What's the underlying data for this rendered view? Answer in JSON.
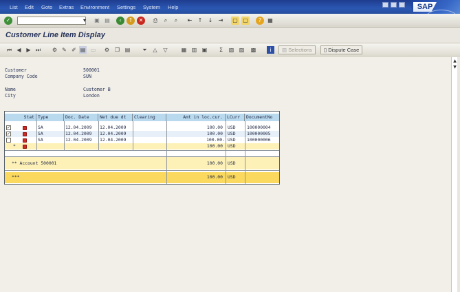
{
  "menu": [
    "List",
    "Edit",
    "Goto",
    "Extras",
    "Environment",
    "Settings",
    "System",
    "Help"
  ],
  "brand": "SAP",
  "title": "Customer Line Item Display",
  "app_buttons": {
    "selections": "Selections",
    "dispute_case": "Dispute Case"
  },
  "header_fields": [
    {
      "label": "Customer",
      "value": "500001"
    },
    {
      "label": "Company Code",
      "value": "SUN"
    },
    {
      "label": "Name",
      "value": "Customer B"
    },
    {
      "label": "City",
      "value": "London"
    }
  ],
  "table": {
    "columns": [
      "Stat",
      "Type",
      "Doc. Date",
      "Net due dt",
      "Clearing",
      "Amt in loc.cur.",
      "LCurr",
      "DocumentNo"
    ],
    "rows": [
      {
        "checked": true,
        "type": "SA",
        "doc_date": "12.04.2009",
        "net_due": "12.04.2009",
        "clearing": "",
        "amount": "100.00",
        "curr": "USD",
        "doc_no": "100000004"
      },
      {
        "checked": true,
        "type": "SA",
        "doc_date": "12.04.2009",
        "net_due": "12.04.2009",
        "clearing": "",
        "amount": "100.00",
        "curr": "USD",
        "doc_no": "100000005"
      },
      {
        "checked": false,
        "type": "SA",
        "doc_date": "12.04.2009",
        "net_due": "12.04.2009",
        "clearing": "",
        "amount": "100.00-",
        "curr": "USD",
        "doc_no": "100000006"
      }
    ],
    "subtotal_marker": "*",
    "subtotal": {
      "amount": "100.00",
      "curr": "USD"
    },
    "account_total": {
      "label": "** Account 500001",
      "amount": "100.00",
      "curr": "USD"
    },
    "grand_total": {
      "label": "***",
      "amount": "100.00",
      "curr": "USD"
    }
  },
  "colors": {
    "menubar": "#2b57b3",
    "header_cells": "#b9d9ee",
    "total_yellow": "#fbd95f",
    "subtotal_yellow": "#fdf1b8",
    "status_red": "#d12a20"
  }
}
